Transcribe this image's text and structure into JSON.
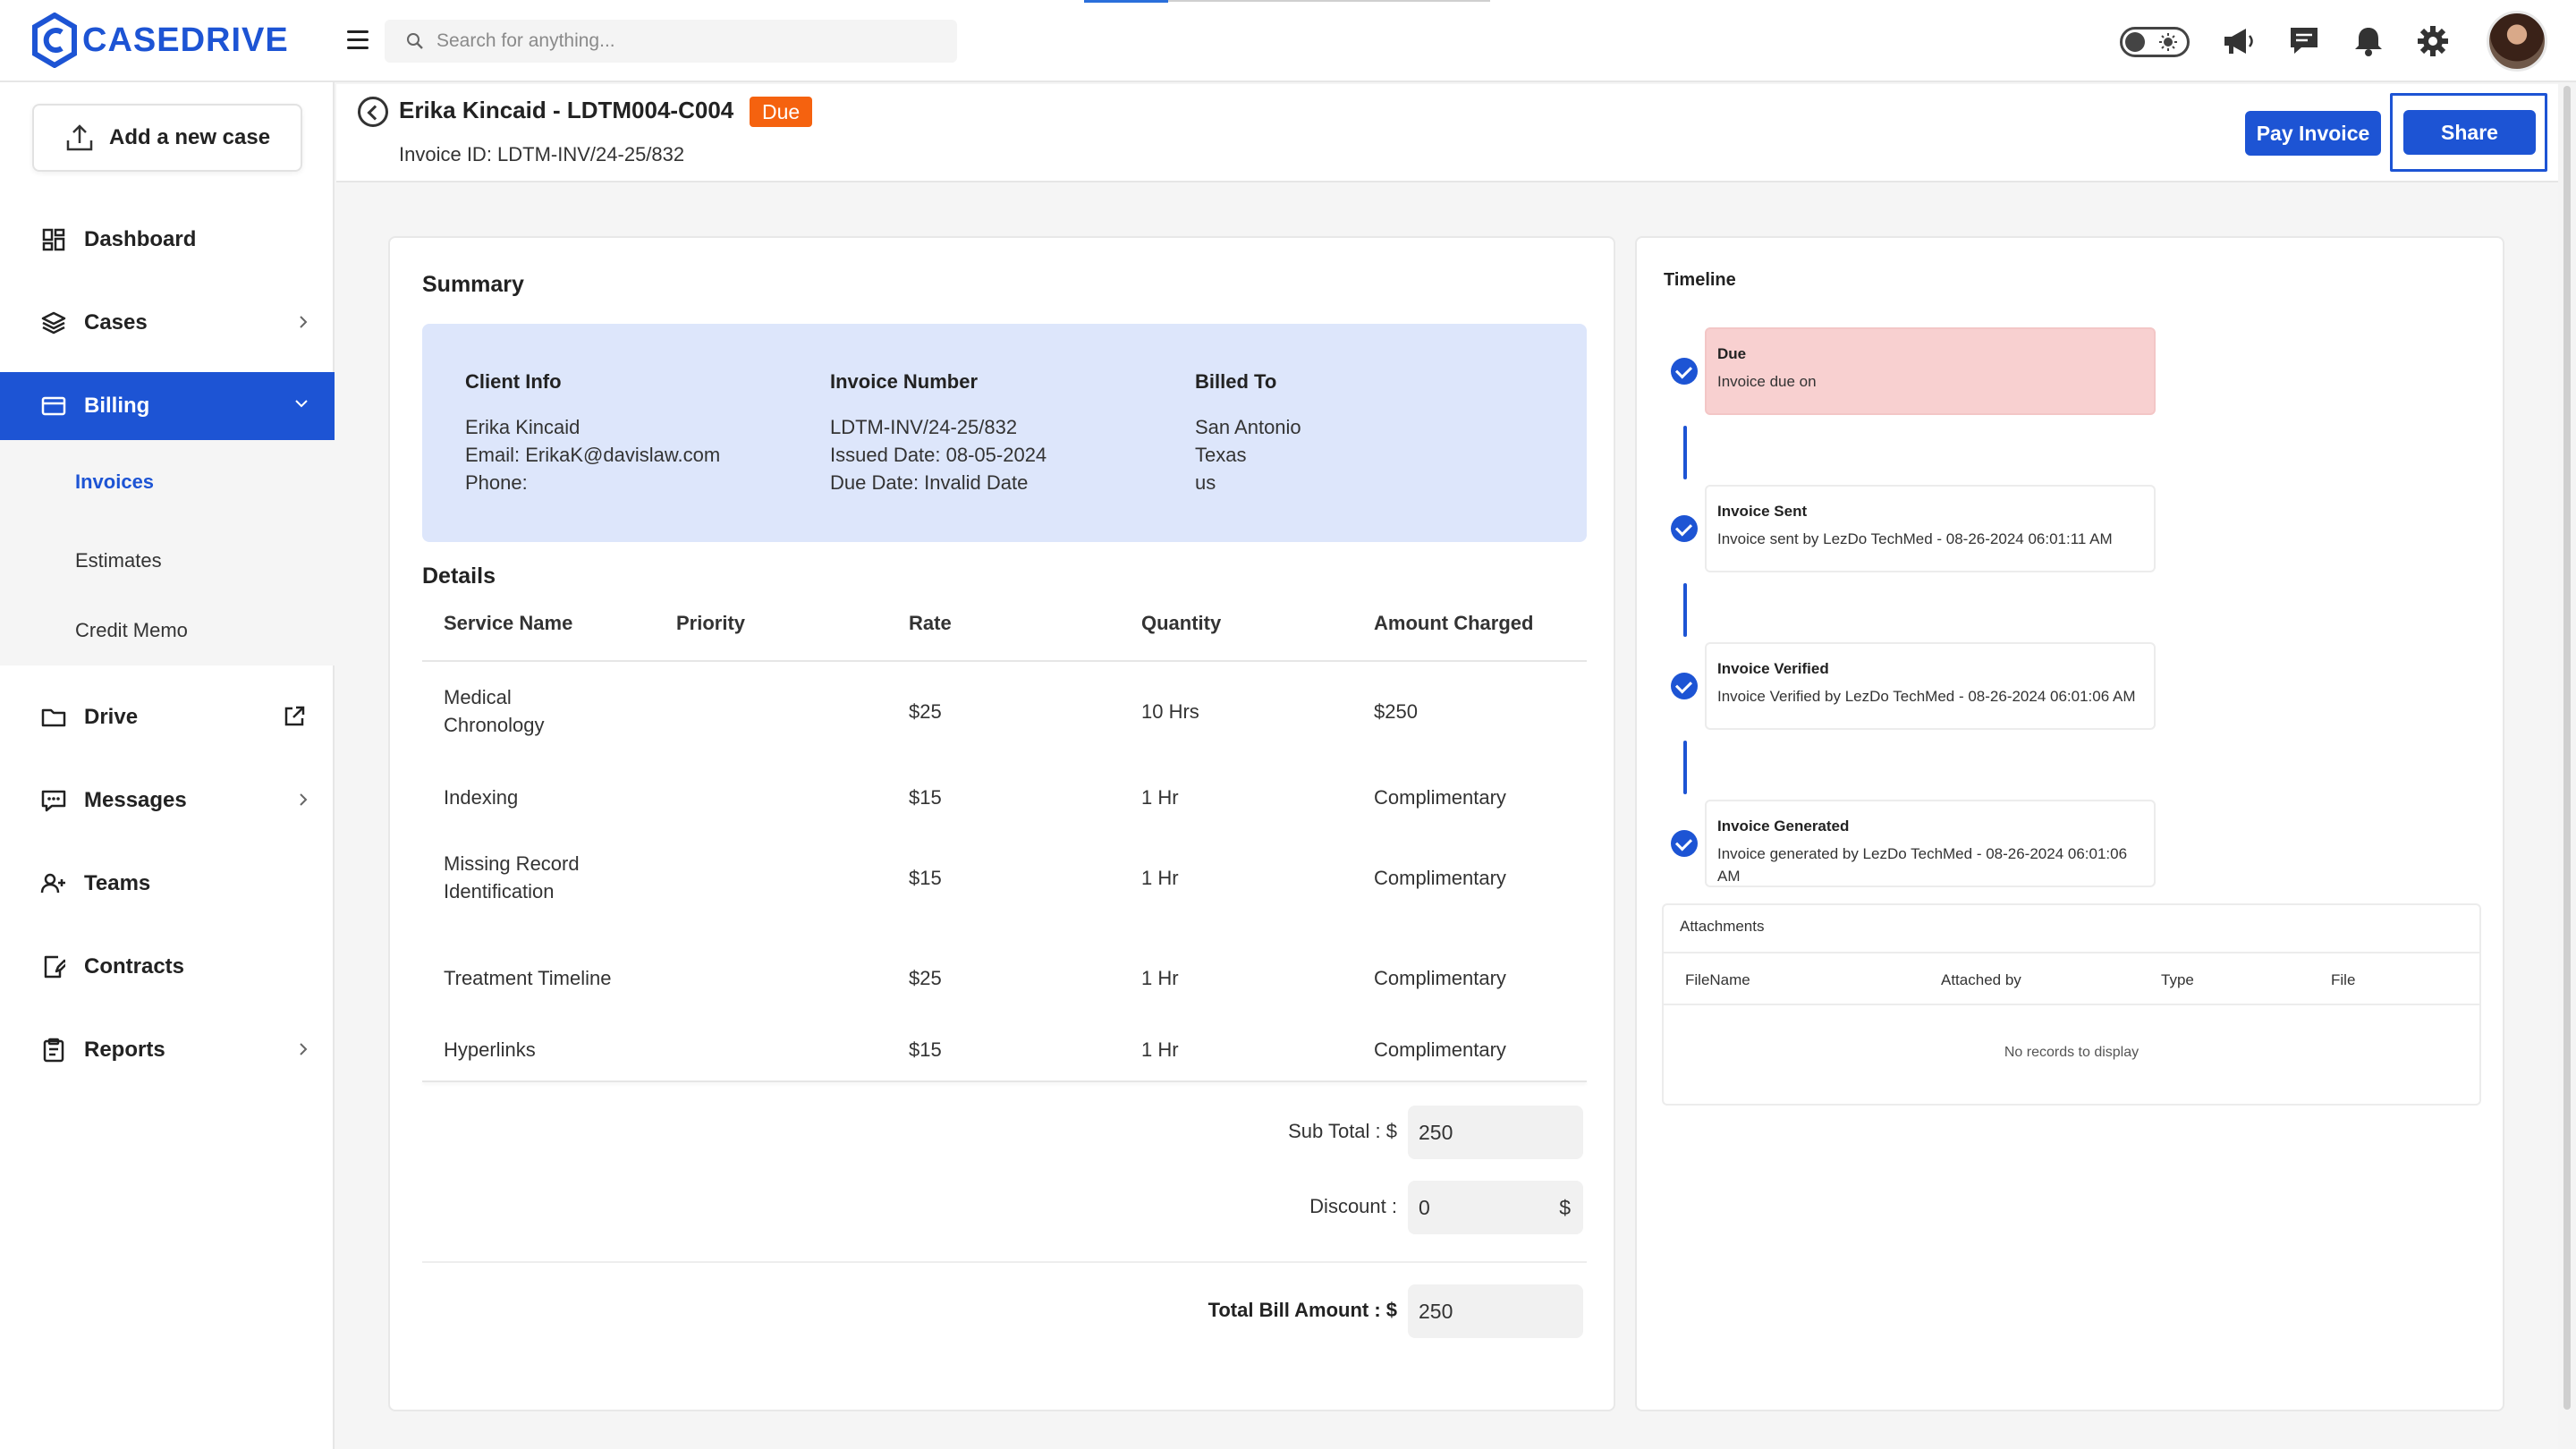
{
  "app": {
    "brand": "CASEDRIVE",
    "search_placeholder": "Search for anything..."
  },
  "sidebar": {
    "add_case_label": "Add a new case",
    "items": [
      {
        "label": "Dashboard",
        "icon": "dashboard-icon"
      },
      {
        "label": "Cases",
        "icon": "layers-icon"
      },
      {
        "label": "Billing",
        "icon": "card-icon"
      },
      {
        "label": "Drive",
        "icon": "folder-icon"
      },
      {
        "label": "Messages",
        "icon": "message-icon"
      },
      {
        "label": "Teams",
        "icon": "users-icon"
      },
      {
        "label": "Contracts",
        "icon": "contract-icon"
      },
      {
        "label": "Reports",
        "icon": "clipboard-icon"
      }
    ],
    "billing_sub": [
      "Invoices",
      "Estimates",
      "Credit Memo"
    ]
  },
  "page": {
    "title": "Erika Kincaid - LDTM004-C004",
    "status": "Due",
    "invoice_id": "Invoice ID: LDTM-INV/24-25/832",
    "pay_label": "Pay Invoice",
    "share_label": "Share"
  },
  "summary": {
    "title": "Summary",
    "client_info": {
      "heading": "Client Info",
      "name": "Erika Kincaid",
      "email": "Email: ErikaK@davislaw.com",
      "phone": "Phone:"
    },
    "invoice_number": {
      "heading": "Invoice Number",
      "number": "LDTM-INV/24-25/832",
      "issued": "Issued Date: 08-05-2024",
      "due": "Due Date: Invalid Date"
    },
    "billed_to": {
      "heading": "Billed To",
      "city": "San Antonio",
      "state": "Texas",
      "country": "us"
    }
  },
  "details": {
    "title": "Details",
    "columns": [
      "Service Name",
      "Priority",
      "Rate",
      "Quantity",
      "Amount Charged"
    ],
    "rows": [
      {
        "service": "Medical Chronology",
        "priority": "",
        "rate": "$25",
        "quantity": "10 Hrs",
        "amount": "$250"
      },
      {
        "service": "Indexing",
        "priority": "",
        "rate": "$15",
        "quantity": "1 Hr",
        "amount": "Complimentary"
      },
      {
        "service": "Missing Record Identification",
        "priority": "",
        "rate": "$15",
        "quantity": "1 Hr",
        "amount": "Complimentary"
      },
      {
        "service": "Treatment Timeline",
        "priority": "",
        "rate": "$25",
        "quantity": "1 Hr",
        "amount": "Complimentary"
      },
      {
        "service": "Hyperlinks",
        "priority": "",
        "rate": "$15",
        "quantity": "1 Hr",
        "amount": "Complimentary"
      }
    ],
    "subtotal_label": "Sub Total : $",
    "subtotal_value": "250",
    "discount_label": "Discount :",
    "discount_value": "0",
    "discount_currency": "$",
    "total_label": "Total Bill Amount : $",
    "total_value": "250"
  },
  "timeline": {
    "title": "Timeline",
    "events": [
      {
        "title": "Due",
        "desc": "Invoice due on"
      },
      {
        "title": "Invoice Sent",
        "desc": "Invoice sent by LezDo TechMed - 08-26-2024 06:01:11 AM"
      },
      {
        "title": "Invoice Verified",
        "desc": "Invoice Verified by LezDo TechMed - 08-26-2024 06:01:06 AM"
      },
      {
        "title": "Invoice Generated",
        "desc": "Invoice generated by LezDo TechMed - 08-26-2024 06:01:06 AM"
      }
    ]
  },
  "attachments": {
    "title": "Attachments",
    "columns": [
      "FileName",
      "Attached by",
      "Type",
      "File"
    ],
    "empty": "No records to display"
  },
  "colors": {
    "brand": "#1d54d4",
    "due_badge": "#f5620f",
    "summary_bg": "#dde6fb",
    "due_box": "#f8d0d0"
  }
}
